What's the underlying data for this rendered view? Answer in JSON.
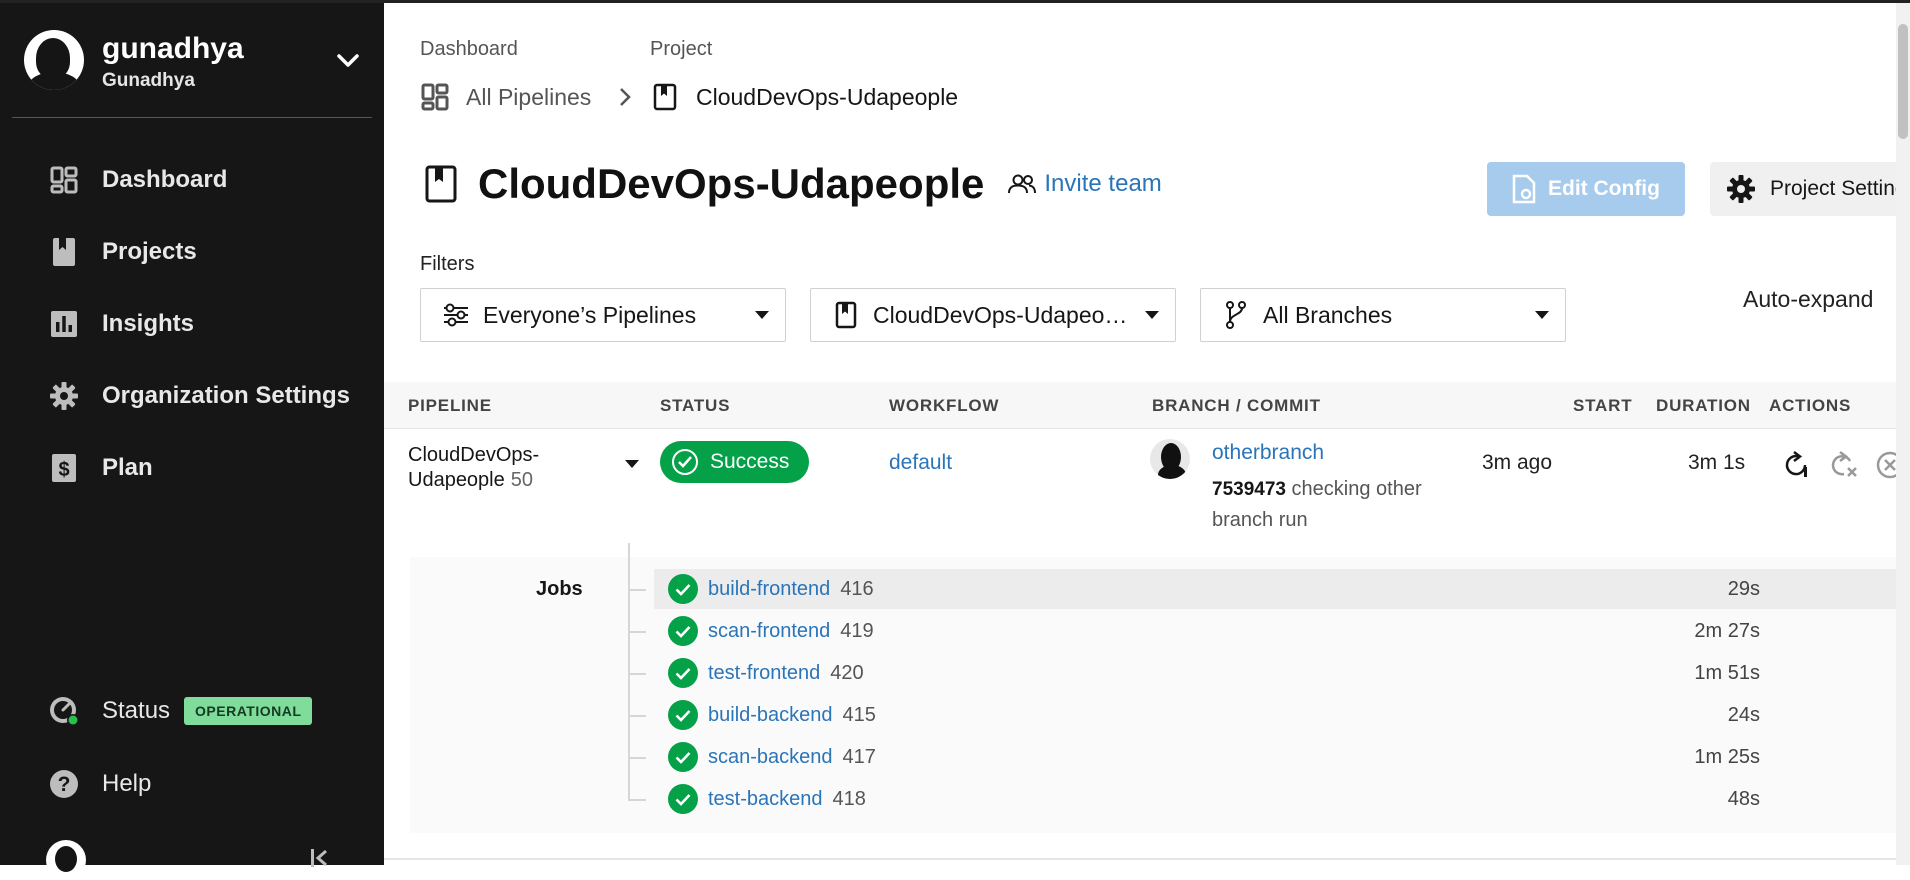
{
  "org": {
    "name": "gunadhya",
    "subname": "Gunadhya"
  },
  "nav": [
    {
      "label": "Dashboard",
      "icon": "dashboard-icon"
    },
    {
      "label": "Projects",
      "icon": "project-icon"
    },
    {
      "label": "Insights",
      "icon": "insights-icon"
    },
    {
      "label": "Organization Settings",
      "icon": "gear-icon"
    },
    {
      "label": "Plan",
      "icon": "plan-icon"
    }
  ],
  "status": {
    "label": "Status",
    "badge": "OPERATIONAL"
  },
  "help": {
    "label": "Help"
  },
  "breadcrumb": {
    "dashboard_label": "Dashboard",
    "dashboard_value": "All Pipelines",
    "project_label": "Project",
    "project_value": "CloudDevOps-Udapeople"
  },
  "project": {
    "title": "CloudDevOps-Udapeople",
    "invite": "Invite team"
  },
  "buttons": {
    "edit_config": "Edit Config",
    "project_settings": "Project Settings"
  },
  "filters": {
    "label": "Filters",
    "pipelines": "Everyone’s Pipelines",
    "project": "CloudDevOps-Udapeople",
    "branches": "All Branches",
    "auto_expand": "Auto-expand"
  },
  "table": {
    "headers": {
      "pipeline": "PIPELINE",
      "status": "STATUS",
      "workflow": "WORKFLOW",
      "branch_commit": "BRANCH / COMMIT",
      "start": "START",
      "duration": "DURATION",
      "actions": "ACTIONS"
    },
    "row": {
      "pipeline_name_line1": "CloudDevOps-",
      "pipeline_name_line2": "Udapeople",
      "pipeline_number": "50",
      "status": "Success",
      "workflow": "default",
      "branch": "otherbranch",
      "commit_hash": "7539473",
      "commit_message": "checking other branch run",
      "start": "3m ago",
      "duration": "3m 1s"
    }
  },
  "jobs": {
    "label": "Jobs",
    "items": [
      {
        "name": "build-frontend",
        "number": "416",
        "duration": "29s"
      },
      {
        "name": "scan-frontend",
        "number": "419",
        "duration": "2m 27s"
      },
      {
        "name": "test-frontend",
        "number": "420",
        "duration": "1m 51s"
      },
      {
        "name": "build-backend",
        "number": "415",
        "duration": "24s"
      },
      {
        "name": "scan-backend",
        "number": "417",
        "duration": "1m 25s"
      },
      {
        "name": "test-backend",
        "number": "418",
        "duration": "48s"
      }
    ]
  },
  "colors": {
    "sidebar": "#161616",
    "success": "#04a149",
    "link": "#2a74b8",
    "badge": "#7fdc9a",
    "edit_button": "#a6cbed"
  }
}
